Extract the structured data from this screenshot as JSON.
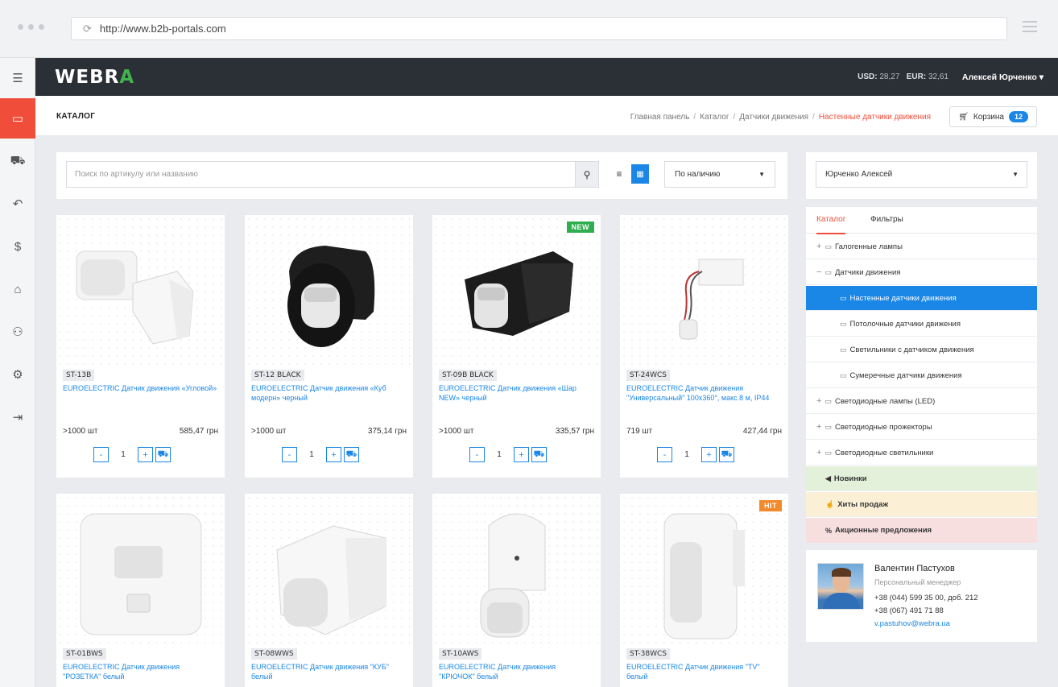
{
  "browser": {
    "url": "http://www.b2b-portals.com"
  },
  "header": {
    "logo": "WEBRA",
    "usd_label": "USD:",
    "usd_value": "28,27",
    "eur_label": "EUR:",
    "eur_value": "32,61",
    "user": "Алексей Юрченко"
  },
  "sidebar": [
    "menu-icon",
    "folder-icon",
    "cart-icon",
    "return-icon",
    "dollar-icon",
    "graduation-icon",
    "users-icon",
    "user-settings-icon",
    "logout-icon"
  ],
  "page": {
    "title": "КАТАЛОГ",
    "breadcrumb": [
      "Главная панель",
      "Каталог",
      "Датчики движения",
      "Настенные датчики движения"
    ],
    "cart_label": "Корзина",
    "cart_count": "12"
  },
  "search": {
    "placeholder": "Поиск по артикулу или названию",
    "sort": "По наличию"
  },
  "products": [
    {
      "sku": "ST-13B",
      "name": "EUROELECTRIC Датчик движения «Угловой»",
      "stock": ">1000 шт",
      "price": "585,47 грн",
      "qty": "1",
      "badge": ""
    },
    {
      "sku": "ST-12 BLACK",
      "name": "EUROELECTRIC Датчик движения «Куб модерн» черный",
      "stock": ">1000 шт",
      "price": "375,14 грн",
      "qty": "1",
      "badge": ""
    },
    {
      "sku": "ST-09B BLACK",
      "name": "EUROELECTRIC Датчик движения «Шар NEW» черный",
      "stock": ">1000 шт",
      "price": "335,57 грн",
      "qty": "1",
      "badge": "NEW"
    },
    {
      "sku": "ST-24WCS",
      "name": "EUROELECTRIC Датчик движения \"Универсальный\" 100х360°, макс.8 м, IP44",
      "stock": "719 шт",
      "price": "427,44 грн",
      "qty": "1",
      "badge": ""
    },
    {
      "sku": "ST-01BWS",
      "name": "EUROELECTRIC Датчик движения \"РОЗЕТКА\" белый",
      "badge": ""
    },
    {
      "sku": "ST-08WWS",
      "name": "EUROELECTRIC Датчик движения \"КУБ\" белый",
      "badge": ""
    },
    {
      "sku": "ST-10AWS",
      "name": "EUROELECTRIC Датчик движения \"КРЮЧОК\" белый",
      "badge": ""
    },
    {
      "sku": "ST-38WCS",
      "name": "EUROELECTRIC Датчик движения \"TV\" белый",
      "badge": "HIT"
    }
  ],
  "client": {
    "selected": "Юрченко Алексей"
  },
  "catalog": {
    "tabs": [
      "Каталог",
      "Фильтры"
    ],
    "items": [
      {
        "label": "Галогенные лампы",
        "sign": "+"
      },
      {
        "label": "Датчики движения",
        "sign": "−"
      },
      {
        "label": "Настенные датчики движения",
        "sign": ""
      },
      {
        "label": "Потолочные датчики движения",
        "sign": ""
      },
      {
        "label": "Светильники с датчиком движения",
        "sign": ""
      },
      {
        "label": "Сумеречные датчики движения",
        "sign": ""
      },
      {
        "label": "Светодиодные лампы (LED)",
        "sign": "+"
      },
      {
        "label": "Светодиодные прожекторы",
        "sign": "+"
      },
      {
        "label": "Светодиодные светильники",
        "sign": "+"
      }
    ],
    "specials": [
      "Новинки",
      "Хиты продаж",
      "Акционные предложения"
    ]
  },
  "manager": {
    "name": "Валентин Пастухов",
    "role": "Персональный менеджер",
    "phone1": "+38 (044) 599 35 00, доб. 212",
    "phone2": "+38 (067) 491 71 88",
    "email": "v.pastuhov@webra.ua"
  },
  "colors": {
    "accent": "#1a86e6",
    "brand_red": "#f04e3a",
    "header_dark": "#2b2f36",
    "new_badge": "#2fae4f",
    "hit_badge": "#f3892a"
  }
}
